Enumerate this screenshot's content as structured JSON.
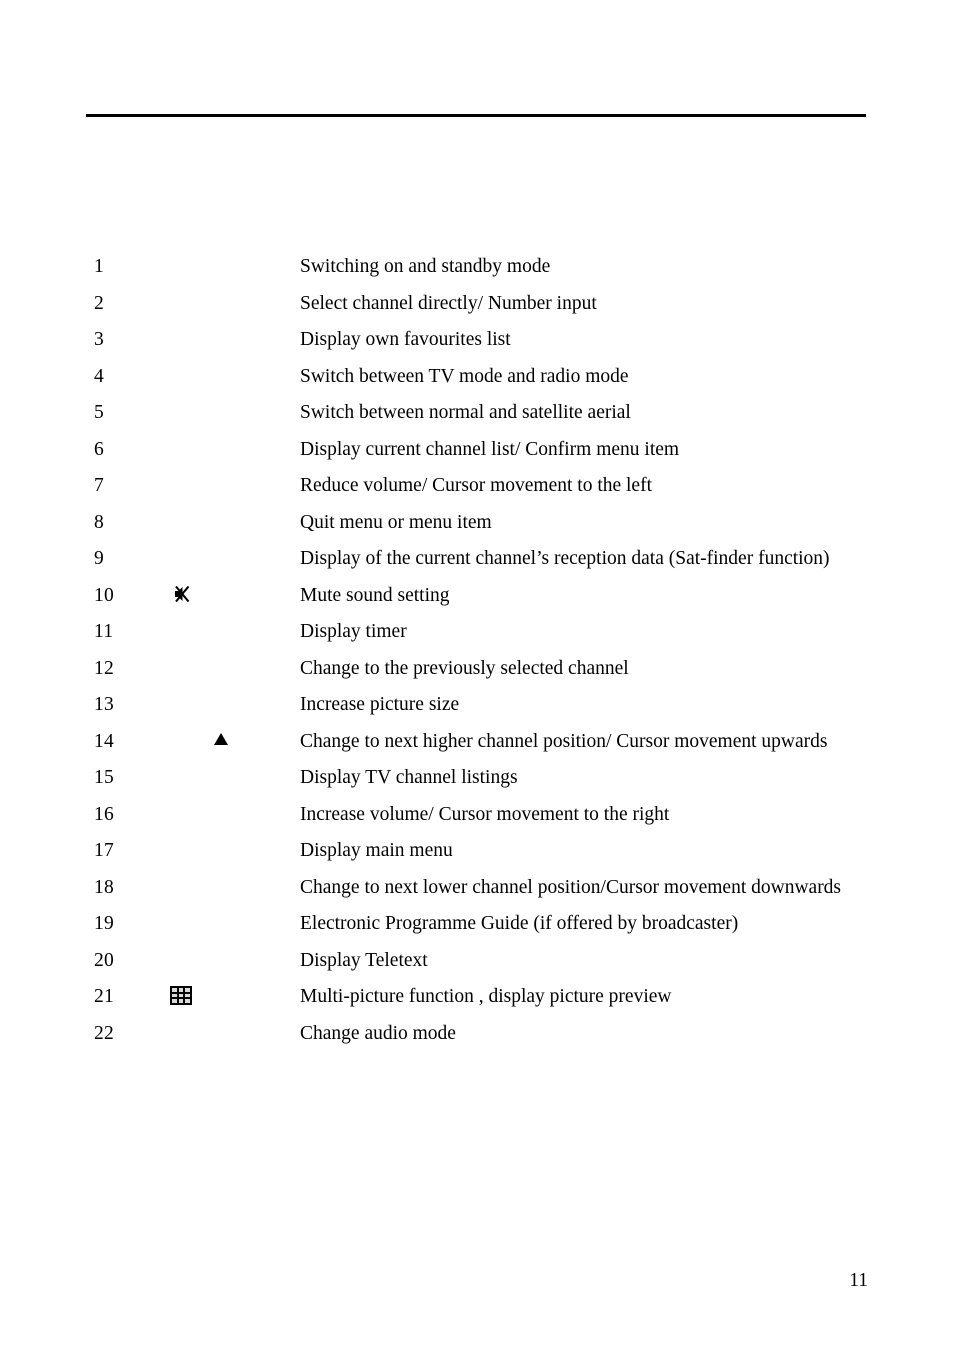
{
  "page": {
    "number": "11",
    "divider": "horizontal-rule"
  },
  "legend": {
    "rows": [
      {
        "num": "1",
        "icon": "",
        "desc": "Switching on and standby mode"
      },
      {
        "num": "2",
        "icon": "",
        "desc": "Select channel directly/ Number input"
      },
      {
        "num": "3",
        "icon": "",
        "desc": "Display own favourites list"
      },
      {
        "num": "4",
        "icon": "",
        "desc": "Switch between TV mode and radio mode"
      },
      {
        "num": "5",
        "icon": "",
        "desc": "Switch between normal and satellite aerial"
      },
      {
        "num": "6",
        "icon": "",
        "desc": "Display current channel list/ Confirm menu item"
      },
      {
        "num": "7",
        "icon": "",
        "desc": "Reduce volume/ Cursor movement to the left"
      },
      {
        "num": "8",
        "icon": "",
        "desc": "Quit menu or menu item"
      },
      {
        "num": "9",
        "icon": "",
        "desc": "Display of the current channel’s reception data (Sat-finder function)"
      },
      {
        "num": "10",
        "icon": "mute-icon",
        "desc": "Mute sound setting"
      },
      {
        "num": "11",
        "icon": "",
        "desc": "Display timer"
      },
      {
        "num": "12",
        "icon": "",
        "desc": "Change to the previously selected channel"
      },
      {
        "num": "13",
        "icon": "",
        "desc": "Increase picture size"
      },
      {
        "num": "14",
        "icon": "triangle-up-icon",
        "desc": "Change to next higher channel position/ Cursor movement upwards"
      },
      {
        "num": "15",
        "icon": "",
        "desc": "Display TV channel listings"
      },
      {
        "num": "16",
        "icon": "",
        "desc": "Increase volume/ Cursor movement to the right"
      },
      {
        "num": "17",
        "icon": "",
        "desc": "Display main menu"
      },
      {
        "num": "18",
        "icon": "",
        "desc": "Change to next lower channel position/Cursor movement downwards"
      },
      {
        "num": "19",
        "icon": "",
        "desc": "Electronic Programme Guide (if offered by broadcaster)"
      },
      {
        "num": "20",
        "icon": "",
        "desc": "Display Teletext"
      },
      {
        "num": "21",
        "icon": "multi-picture-grid-icon",
        "desc": "Multi-picture function , display picture preview"
      },
      {
        "num": "22",
        "icon": "",
        "desc": "Change audio mode"
      }
    ]
  }
}
